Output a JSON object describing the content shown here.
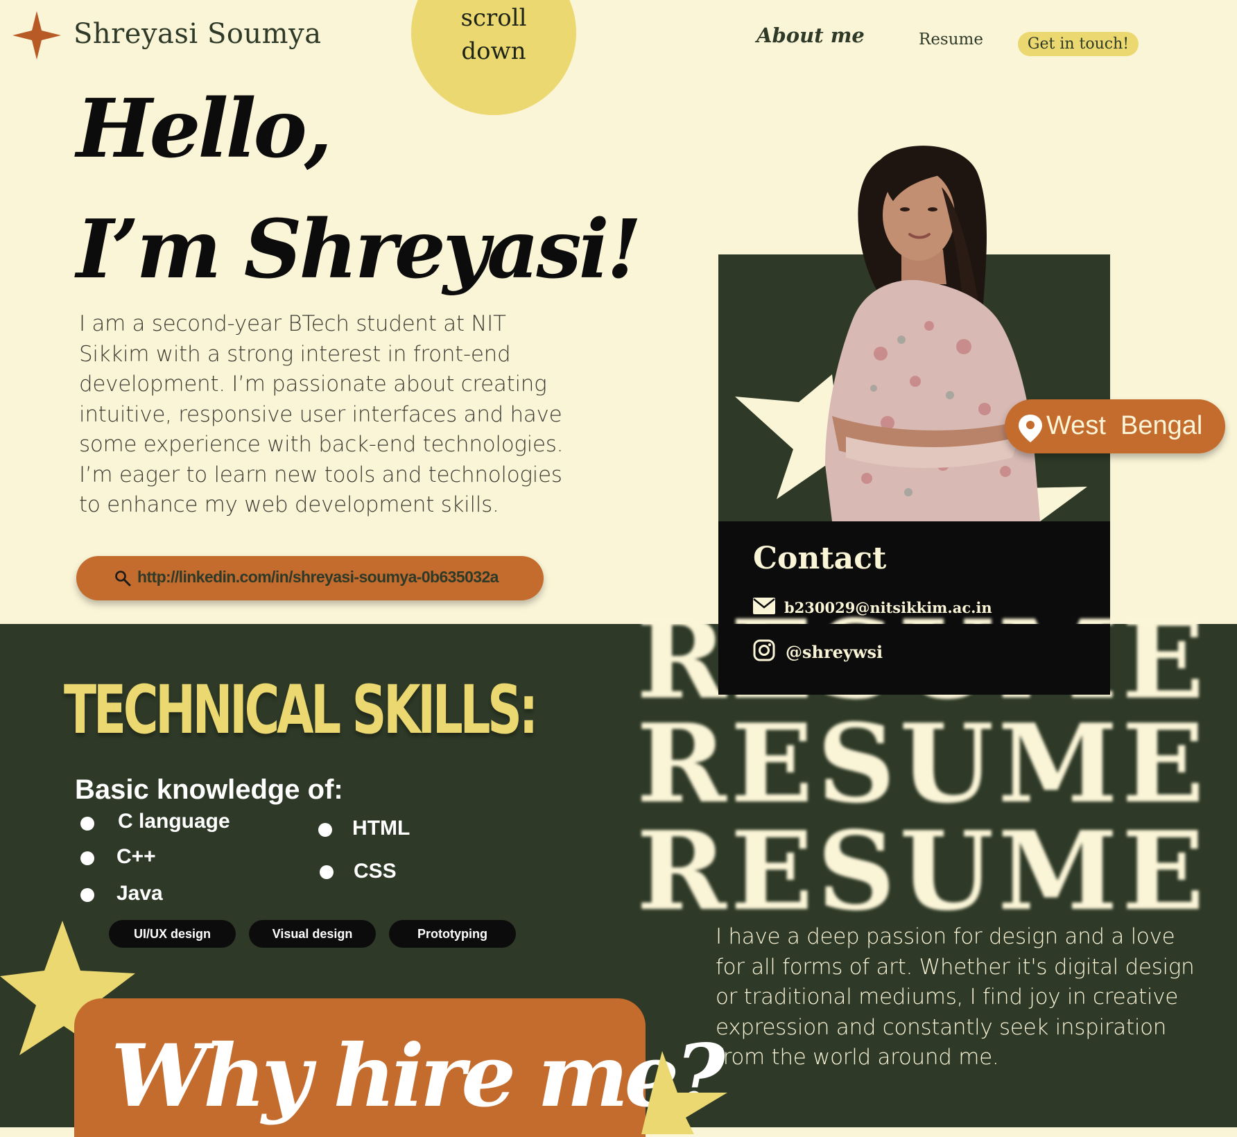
{
  "header": {
    "brand_name": "Shreyasi Soumya",
    "brand_icon": "four-point-star-icon",
    "scroll_hint_line1": "scroll",
    "scroll_hint_line2": "down",
    "nav": {
      "about": "About me",
      "resume": "Resume",
      "cta": "Get in touch!"
    }
  },
  "hero": {
    "line1": "Hello,",
    "line2": "I’m Shreyasi!",
    "intro": "I am a second-year BTech student at NIT Sikkim with a strong interest in front-end development. I’m passionate about creating intuitive, responsive user interfaces and have some experience with back-end technologies. I’m eager to learn new tools and technologies to enhance my web development skills.",
    "link": "http://linkedin.com/in/shreyasi-soumya-0b635032a",
    "link_icon": "search-icon"
  },
  "profile": {
    "location": "West  Bengal",
    "location_icon": "map-pin-icon",
    "contact_title": "Contact",
    "email": "b230029@nitsikkim.ac.in",
    "email_icon": "mail-icon",
    "instagram": "@shreywsi",
    "instagram_icon": "instagram-icon"
  },
  "skills": {
    "title": "TECHNICAL SKILLS:",
    "subtitle": "Basic knowledge of:",
    "column1": [
      "C language",
      "C++",
      "Java"
    ],
    "column2": [
      "HTML",
      "CSS"
    ],
    "tags": [
      "UI/UX design",
      "Visual design",
      "Prototyping"
    ]
  },
  "resume": {
    "word": "RESUME",
    "about": "I have a deep passion for design and a love for all forms of art. Whether it's digital design or traditional mediums, I find joy in creative expression and constantly seek inspiration from the world around me."
  },
  "hire": {
    "title": "Why hire me?"
  },
  "colors": {
    "cream": "#fbf5d8",
    "dark_green": "#2e3a27",
    "yellow": "#ebd870",
    "orange": "#c46b2e",
    "black": "#0c0c0c"
  }
}
